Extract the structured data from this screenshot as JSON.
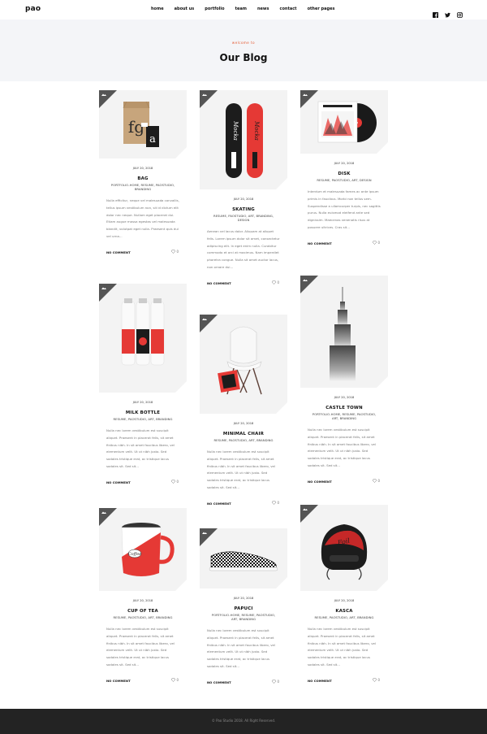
{
  "header": {
    "logo": "pao",
    "nav": [
      "home",
      "about us",
      "portfolio",
      "team",
      "news",
      "contact",
      "other pages"
    ],
    "social_icons": [
      "facebook-icon",
      "twitter-icon",
      "instagram-icon"
    ]
  },
  "hero": {
    "welcome": "welcome to",
    "title": "Our Blog"
  },
  "posts": [
    {
      "title": "BAG",
      "date": "JULY 20, 2018",
      "categories": "PORTFOLIO-HOME, RESUME, PAOSTUDIO, BRANDING",
      "excerpt": "Nulla efficitur, neque vel malesuada convallis, tellus ipsum vestibulum non, sit id dictum elit dolor nec neque. Nullam eget placerat dui. Etiam augue massa egestas vel malesuada blandit, volutpat eget nulla. Praesent quis dui vel urna...",
      "comment": "NO COMMENT",
      "likes": "0"
    },
    {
      "title": "SKATING",
      "date": "JULY 20, 2018",
      "categories": "RESUME, PAOSTUDIO, ART, BRANDING, DESIGN",
      "excerpt": "Aenean vel lacus dolor. Aliquam at aliquet felis. Lorem ipsum dolor sit amet, consectetur adipiscing elit. In eget enim nulla. Curabitur commodo et orci at maximus. Nam imperdiet pharetra congue. Nulla sit amet auctor lacus, non ornare dui...",
      "comment": "NO COMMENT",
      "likes": "0"
    },
    {
      "title": "DISK",
      "date": "JULY 20, 2018",
      "categories": "RESUME, PAOSTUDIO, ART, DESIGN",
      "excerpt": "Interdum et malesuada fames ac ante ipsum primis in faucibus. Morbi non tellus sem. Suspendisse a ullamcorper turpis, nec sagittis purus. Nulla euismod eleifend ante sed dignissim. Maecenas venenatis risus at posuere ultrices. Cras sit...",
      "comment": "NO COMMENT",
      "likes": "0"
    },
    {
      "title": "MILK BOTTLE",
      "date": "JULY 20, 2018",
      "categories": "RESUME, PAOSTUDIO, ART, BRANDING",
      "excerpt": "Nulla nec lorem vestibulum est suscipit aliquet. Praesent in placerat felis, sit amet finibus nibh. In sit amet faucibus libero, vel elementum velit. Ut ut nibh justo. Sed sodales tristique erat, ac tristique lacus sodales sit. Sed sit...",
      "comment": "NO COMMENT",
      "likes": "0"
    },
    {
      "title": "MINIMAL CHAIR",
      "date": "JULY 20, 2018",
      "categories": "RESUME, PAOSTUDIO, ART, BRANDING",
      "excerpt": "Nulla nec lorem vestibulum est suscipit aliquet. Praesent in placerat felis, sit amet finibus nibh. In sit amet faucibus libero, vel elementum velit. Ut ut nibh justo. Sed sodales tristique erat, ac tristique lacus sodales sit. Sed sit...",
      "comment": "NO COMMENT",
      "likes": "0"
    },
    {
      "title": "CASTLE TOWN",
      "date": "JULY 20, 2018",
      "categories": "PORTFOLIO-HOME, RESUME, PAOSTUDIO, ART, BRANDING",
      "excerpt": "Nulla nec lorem vestibulum est suscipit aliquet. Praesent in placerat felis, sit amet finibus nibh. In sit amet faucibus libero, vel elementum velit. Ut ut nibh justo. Sed sodales tristique erat, ac tristique lacus sodales sit. Sed sit...",
      "comment": "NO COMMENT",
      "likes": "0"
    },
    {
      "title": "CUP OF TEA",
      "date": "JULY 20, 2018",
      "categories": "RESUME, PAOSTUDIO, ART, BRANDING",
      "excerpt": "Nulla nec lorem vestibulum est suscipit aliquet. Praesent in placerat felis, sit amet finibus nibh. In sit amet faucibus libero, vel elementum velit. Ut ut nibh justo. Sed sodales tristique erat, ac tristique lacus sodales sit. Sed sit...",
      "comment": "NO COMMENT",
      "likes": "0"
    },
    {
      "title": "PAPUCI",
      "date": "JULY 20, 2018",
      "categories": "PORTFOLIO-HOME, RESUME, PAOSTUDIO, ART, BRANDING",
      "excerpt": "Nulla nec lorem vestibulum est suscipit aliquet. Praesent in placerat felis, sit amet finibus nibh. In sit amet faucibus libero, vel elementum velit. Ut ut nibh justo. Sed sodales tristique erat, ac tristique lacus sodales sit. Sed sit...",
      "comment": "NO COMMENT",
      "likes": "0"
    },
    {
      "title": "KASCA",
      "date": "JULY 20, 2018",
      "categories": "RESUME, PAOSTUDIO, ART, BRANDING",
      "excerpt": "Nulla nec lorem vestibulum est suscipit aliquet. Praesent in placerat felis, sit amet finibus nibh. In sit amet faucibus libero, vel elementum velit. Ut ut nibh justo. Sed sodales tristique erat, ac tristique lacus sodales sit. Sed sit...",
      "comment": "NO COMMENT",
      "likes": "0"
    }
  ],
  "footer": {
    "copyright": "© Pao Studio 2018. All Right Reserved."
  },
  "colors": {
    "accent": "#e4572e",
    "hero_bg": "#f4f5f8",
    "footer_bg": "#232323",
    "corner": "#555555"
  }
}
